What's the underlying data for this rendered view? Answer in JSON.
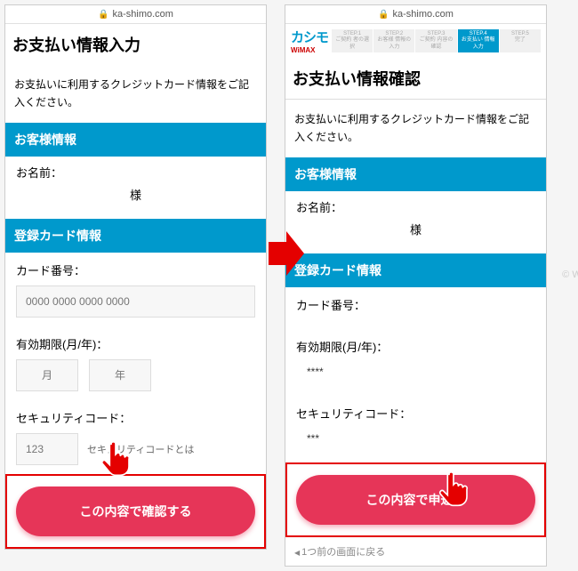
{
  "url": "ka-shimo.com",
  "brand": {
    "name": "カシモ",
    "sub": "WiMAX"
  },
  "steps": [
    {
      "num": "STEP.1",
      "label": "ご契約\n者の選択"
    },
    {
      "num": "STEP.2",
      "label": "お客様\n情報の入力"
    },
    {
      "num": "STEP.3",
      "label": "ご契約\n内容の確認"
    },
    {
      "num": "STEP.4",
      "label": "お支払い\n情報入力"
    },
    {
      "num": "STEP.5",
      "label": "完了"
    }
  ],
  "left": {
    "title": "お支払い情報入力",
    "desc": "お支払いに利用するクレジットカード情報をご記入ください。",
    "sec_customer": "お客様情報",
    "name_label": "お名前：",
    "name_value": "様",
    "sec_card": "登録カード情報",
    "card_label": "カード番号：",
    "card_placeholder": "0000 0000 0000 0000",
    "exp_label": "有効期限(月/年)：",
    "exp_m": "月",
    "exp_y": "年",
    "cvv_label": "セキュリティコード：",
    "cvv_placeholder": "123",
    "cvv_hint": "セキュリティコードとは",
    "button": "この内容で確認する"
  },
  "right": {
    "title": "お支払い情報確認",
    "desc": "お支払いに利用するクレジットカード情報をご記入ください。",
    "sec_customer": "お客様情報",
    "name_label": "お名前：",
    "name_value": "様",
    "sec_card": "登録カード情報",
    "card_label": "カード番号：",
    "exp_label": "有効期限(月/年)：",
    "exp_value": "****",
    "cvv_label": "セキュリティコード：",
    "cvv_value": "***",
    "button": "この内容で申込む",
    "back": "1つ前の画面に戻る"
  },
  "watermark": "© Wi-Fiの"
}
